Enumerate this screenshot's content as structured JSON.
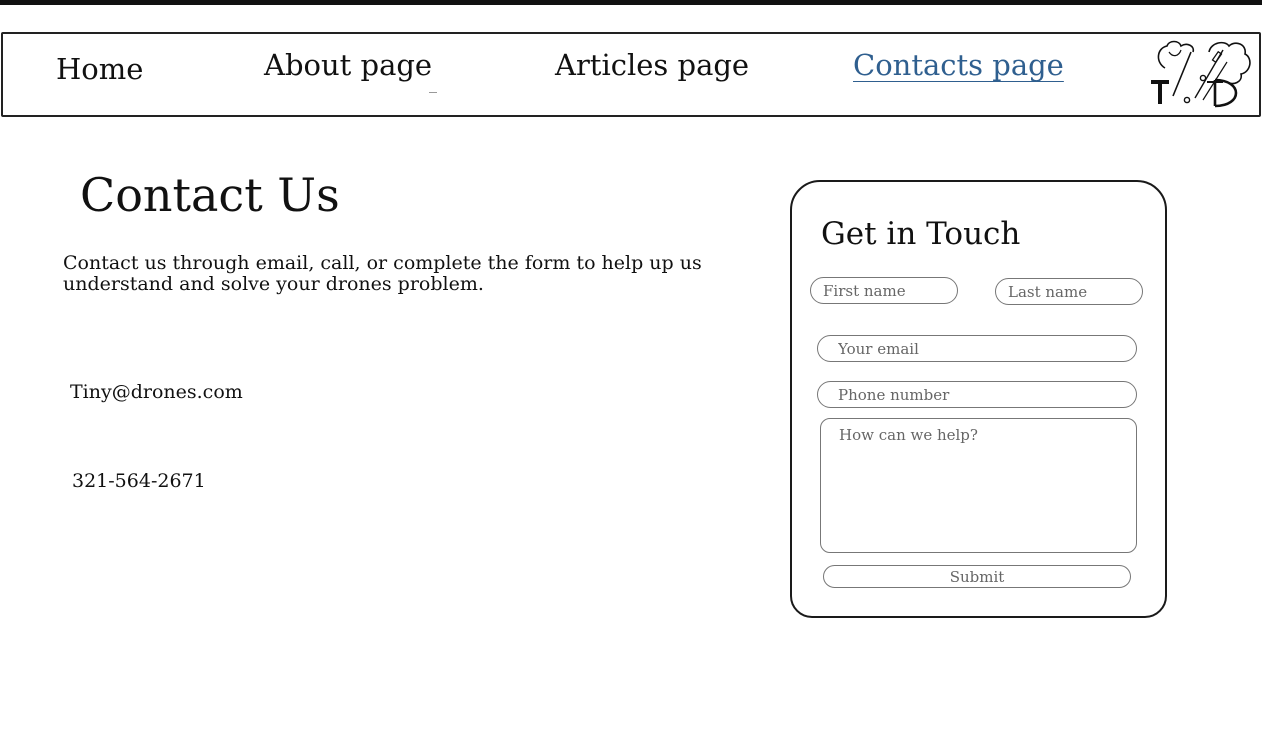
{
  "nav": {
    "home": "Home",
    "about": "About page",
    "articles": "Articles page",
    "contacts": "Contacts page"
  },
  "logo": {
    "text": "T.D",
    "icon": "drone-logo-icon"
  },
  "main": {
    "title": "Contact Us",
    "intro": "Contact us through email, call, or complete the form to help up us understand and solve your drones problem.",
    "email": "Tiny@drones.com",
    "phone": "321-564-2671"
  },
  "form": {
    "title": "Get in Touch",
    "first_name_placeholder": "First name",
    "last_name_placeholder": "Last name",
    "email_placeholder": "Your email",
    "phone_placeholder": "Phone number",
    "message_placeholder": "How can we help?",
    "submit_label": "Submit"
  },
  "colors": {
    "active_link": "#2f5f8f",
    "border": "#1a1a1a"
  }
}
